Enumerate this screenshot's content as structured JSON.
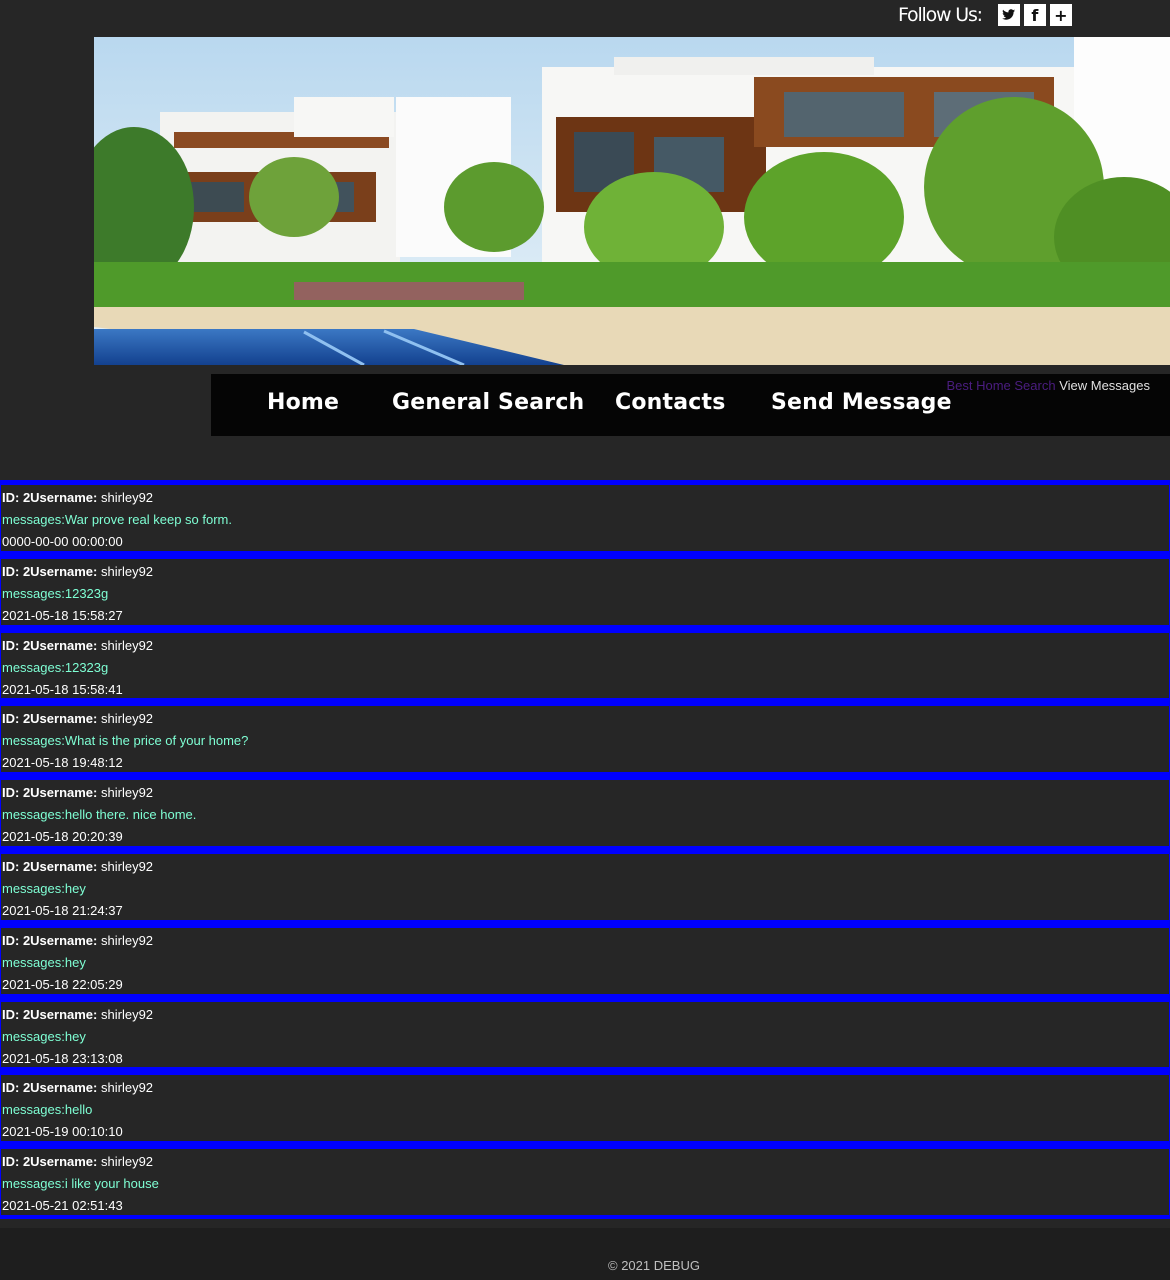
{
  "follow": {
    "label": "Follow Us:",
    "icons": [
      "twitter-icon",
      "facebook-icon",
      "plus-icon"
    ]
  },
  "nav": {
    "items": [
      "Home",
      "General Search",
      "Contacts",
      "Send Message"
    ],
    "link_best": "Best Home Search",
    "link_view": "View Messages"
  },
  "messages": [
    {
      "id_label": "ID: 2",
      "user_label": "Username:",
      "username": "shirley92",
      "message": "messages:War prove real keep so form.",
      "timestamp": "0000-00-00 00:00:00"
    },
    {
      "id_label": "ID: 2",
      "user_label": "Username:",
      "username": "shirley92",
      "message": "messages:12323g",
      "timestamp": "2021-05-18 15:58:27"
    },
    {
      "id_label": "ID: 2",
      "user_label": "Username:",
      "username": "shirley92",
      "message": "messages:12323g",
      "timestamp": "2021-05-18 15:58:41"
    },
    {
      "id_label": "ID: 2",
      "user_label": "Username:",
      "username": "shirley92",
      "message": "messages:What is the price of your home?",
      "timestamp": "2021-05-18 19:48:12"
    },
    {
      "id_label": "ID: 2",
      "user_label": "Username:",
      "username": "shirley92",
      "message": "messages:hello there. nice home.",
      "timestamp": "2021-05-18 20:20:39"
    },
    {
      "id_label": "ID: 2",
      "user_label": "Username:",
      "username": "shirley92",
      "message": "messages:hey",
      "timestamp": "2021-05-18 21:24:37"
    },
    {
      "id_label": "ID: 2",
      "user_label": "Username:",
      "username": "shirley92",
      "message": "messages:hey",
      "timestamp": "2021-05-18 22:05:29"
    },
    {
      "id_label": "ID: 2",
      "user_label": "Username:",
      "username": "shirley92",
      "message": "messages:hey",
      "timestamp": "2021-05-18 23:13:08"
    },
    {
      "id_label": "ID: 2",
      "user_label": "Username:",
      "username": "shirley92",
      "message": "messages:hello",
      "timestamp": "2021-05-19 00:10:10"
    },
    {
      "id_label": "ID: 2",
      "user_label": "Username:",
      "username": "shirley92",
      "message": "messages:i like your house",
      "timestamp": "2021-05-21 02:51:43"
    }
  ],
  "footer": {
    "text": "© 2021 DEBUG"
  },
  "colors": {
    "background": "#262626",
    "separator": "#0000ff",
    "message_text": "#7fffd4",
    "nav_bar": "#050505"
  }
}
